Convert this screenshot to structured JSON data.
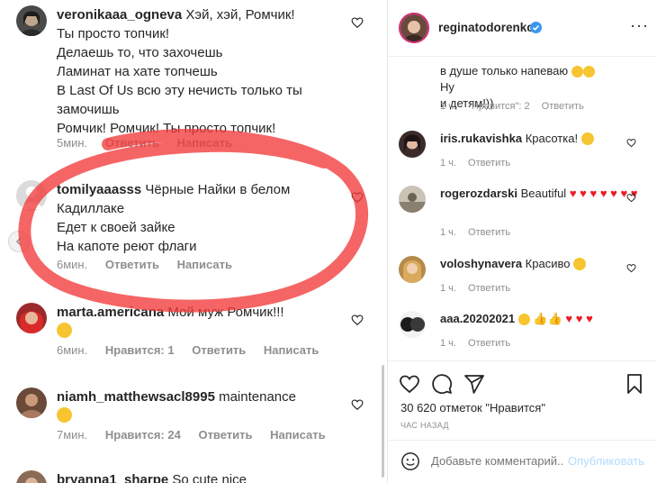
{
  "left_comments": [
    {
      "username": "veronikaaa_ogneva",
      "lines": [
        "Хэй, хэй, Ромчик!",
        "Ты просто топчик!",
        "Делаешь то, что захочешь",
        "Ламинат на хате топчешь",
        "В Last Of Us всю эту нечисть только ты",
        "замочишь",
        "Ромчик! Ромчик! Ты просто топчик!"
      ],
      "time": "5мин.",
      "reply": "Ответить",
      "message": "Написать"
    },
    {
      "username": "tomilyaaasss",
      "lines": [
        "Чёрные Найки в белом",
        "Кадиллаке",
        "Едет к своей зайке",
        "На капоте реют флаги"
      ],
      "time": "6мин.",
      "reply": "Ответить",
      "message": "Написать"
    },
    {
      "username": "marta.americana",
      "lines": [
        "Мой муж Ромчик!!!"
      ],
      "time": "6мин.",
      "likes": "Нравится: 1",
      "reply": "Ответить",
      "message": "Написать"
    },
    {
      "username": "niamh_matthewsacl8995",
      "lines": [
        "maintenance"
      ],
      "time": "7мин.",
      "likes": "Нравится: 24",
      "reply": "Ответить",
      "message": "Написать"
    },
    {
      "username": "bryanna1_sharpe",
      "lines": [
        "So cute nice"
      ]
    }
  ],
  "post": {
    "author": "reginatodorenko",
    "caption_tail": [
      "в душе только напеваю",
      "Ну",
      "и детям!))"
    ],
    "caption_meta": {
      "time": "1 ч.",
      "likes": "\"Нравится\": 2",
      "reply": "Ответить"
    },
    "likes_count": "30 620 отметок \"Нравится\"",
    "time_ago": "ЧАС НАЗАД",
    "comment_placeholder": "Добавьте комментарий...",
    "publish_label": "Опубликовать"
  },
  "right_comments": [
    {
      "username": "iris.rukavishka",
      "text": "Красотка!",
      "time": "1 ч.",
      "reply": "Ответить"
    },
    {
      "username": "rogerozdarski",
      "text": "Beautiful",
      "time": "1 ч.",
      "reply": "Ответить"
    },
    {
      "username": "voloshynavera",
      "text": "Красиво",
      "time": "1 ч.",
      "reply": "Ответить"
    },
    {
      "username": "aaa.20202021",
      "text": "",
      "time": "1 ч.",
      "reply": "Ответить"
    }
  ],
  "colors": {
    "accent_blue": "#0095f6",
    "scribble_red": "#f23a3a",
    "heart_red": "#ed1c24",
    "verified_blue": "#3897f0"
  },
  "icons": [
    "heart-icon",
    "comment-icon",
    "share-icon",
    "bookmark-icon",
    "smile-icon",
    "chevron-left-icon",
    "verified-icon",
    "more-icon"
  ]
}
